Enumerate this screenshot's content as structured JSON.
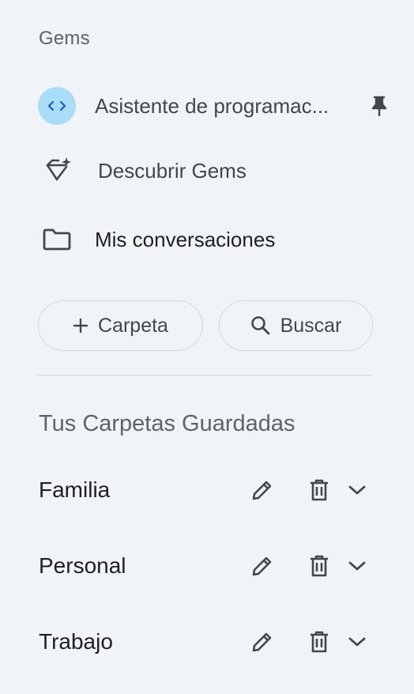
{
  "sidebar": {
    "section_title": "Gems",
    "gem_item": {
      "label": "Asistente de programac...",
      "icon": "code-icon"
    },
    "discover_item": {
      "label": "Descubrir Gems",
      "icon": "sparkle-diamond-icon"
    },
    "conversations_item": {
      "label": "Mis conversaciones",
      "icon": "folder-icon"
    },
    "buttons": {
      "folder_label": "Carpeta",
      "search_label": "Buscar"
    },
    "saved_folders": {
      "title": "Tus Carpetas Guardadas",
      "items": [
        {
          "name": "Familia"
        },
        {
          "name": "Personal"
        },
        {
          "name": "Trabajo"
        }
      ]
    }
  },
  "colors": {
    "background": "#f0f4f9",
    "gem_avatar": "#a8dcf7",
    "gem_code": "#0b57d0",
    "text_primary": "#1f1f1f",
    "text_secondary": "#5f6368",
    "icon": "#444746",
    "border": "#d3d8de"
  }
}
